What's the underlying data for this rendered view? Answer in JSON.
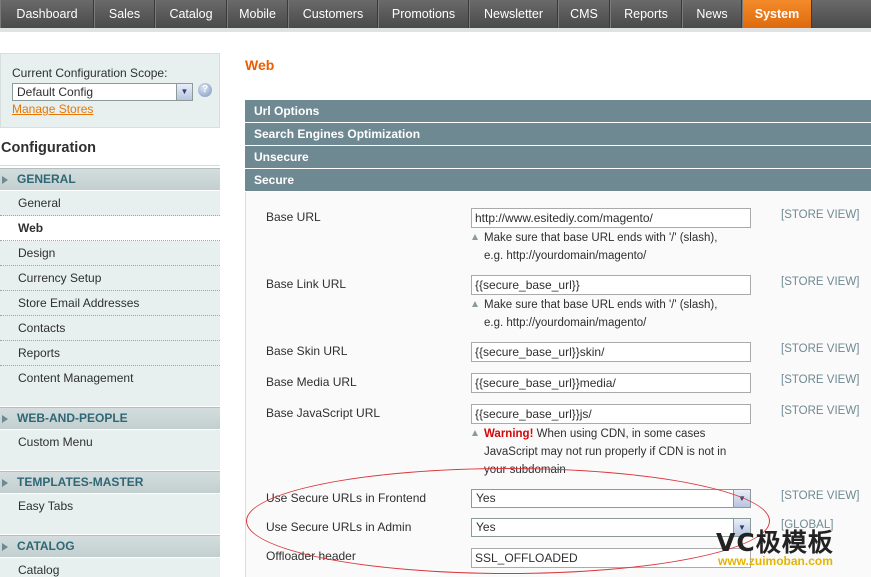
{
  "topnav": {
    "items": [
      "Dashboard",
      "Sales",
      "Catalog",
      "Mobile",
      "Customers",
      "Promotions",
      "Newsletter",
      "CMS",
      "Reports",
      "News",
      "System"
    ],
    "active": "System"
  },
  "scope": {
    "label": "Current Configuration Scope:",
    "selected": "Default Config",
    "help": "?",
    "manage_link": "Manage Stores"
  },
  "sidebar": {
    "title": "Configuration",
    "sections": [
      {
        "label": "GENERAL",
        "items": [
          "General",
          "Web",
          "Design",
          "Currency Setup",
          "Store Email Addresses",
          "Contacts",
          "Reports",
          "Content Management"
        ]
      },
      {
        "label": "WEB-AND-PEOPLE",
        "items": [
          "Custom Menu"
        ]
      },
      {
        "label": "TEMPLATES-MASTER",
        "items": [
          "Easy Tabs"
        ]
      },
      {
        "label": "CATALOG",
        "items": [
          "Catalog"
        ]
      }
    ],
    "active_item": "Web"
  },
  "main": {
    "title": "Web",
    "fieldsets": [
      "Url Options",
      "Search Engines Optimization",
      "Unsecure",
      "Secure"
    ],
    "rows": [
      {
        "label": "Base URL",
        "value": "http://www.esitediy.com/magento/",
        "scope": "[STORE VIEW]",
        "note": [
          "Make sure that base URL ends with '/' (slash),",
          "e.g. http://yourdomain/magento/"
        ]
      },
      {
        "label": "Base Link URL",
        "value": "{{secure_base_url}}",
        "scope": "[STORE VIEW]",
        "note": [
          "Make sure that base URL ends with '/' (slash),",
          "e.g. http://yourdomain/magento/"
        ]
      },
      {
        "label": "Base Skin URL",
        "value": "{{secure_base_url}}skin/",
        "scope": "[STORE VIEW]"
      },
      {
        "label": "Base Media URL",
        "value": "{{secure_base_url}}media/",
        "scope": "[STORE VIEW]"
      },
      {
        "label": "Base JavaScript URL",
        "value": "{{secure_base_url}}js/",
        "scope": "[STORE VIEW]",
        "warning": {
          "strong": "Warning!",
          "lines": [
            " When using CDN, in some cases",
            "JavaScript may not run properly if CDN is not in",
            "your subdomain"
          ]
        }
      },
      {
        "label": "Use Secure URLs in Frontend",
        "value": "Yes",
        "scope": "[STORE VIEW]"
      },
      {
        "label": "Use Secure URLs in Admin",
        "value": "Yes",
        "scope": "[GLOBAL]"
      },
      {
        "label": "Offloader header",
        "value": "SSL_OFFLOADED",
        "scope": ""
      }
    ]
  },
  "watermark": {
    "main": "VC极模板",
    "sub": "www.zuimoban.com"
  },
  "colors": {
    "accent": "#eb5e00",
    "nav_active": "#f48b2a",
    "fieldset_head": "#6f8992",
    "annotation": "#d9383d"
  }
}
